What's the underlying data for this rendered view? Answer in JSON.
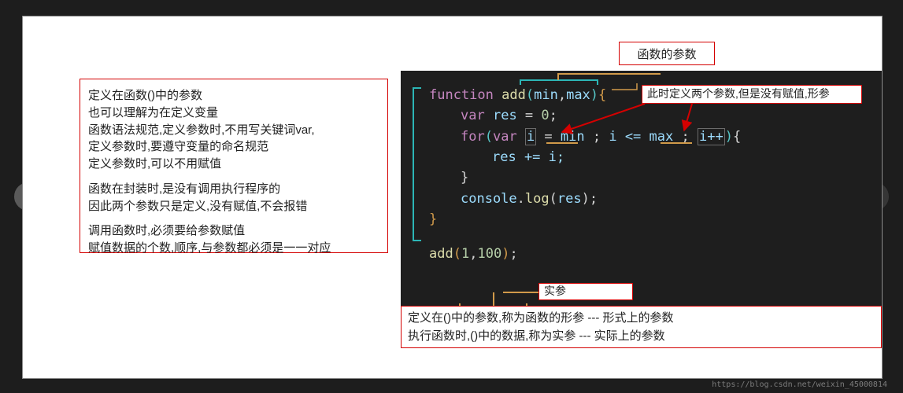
{
  "slide": {
    "title": "函数的参数",
    "left_notes": {
      "p1": "定义在函数()中的参数\n也可以理解为在定义变量\n函数语法规范,定义参数时,不用写关键词var,\n定义参数时,要遵守变量的命名规范\n定义参数时,可以不用赋值",
      "p2": "函数在封装时,是没有调用执行程序的\n因此两个参数只是定义,没有赋值,不会报错",
      "p3": "调用函数时,必须要给参数赋值\n赋值数据的个数,顺序,与参数都必须是一一对应"
    },
    "code": {
      "l1_kw": "function",
      "l1_fn": "add",
      "l1_p1": "min",
      "l1_p2": "max",
      "l2_kw": "var",
      "l2_id": "res",
      "l2_eq": " = ",
      "l2_num": "0",
      "l3_kw": "for",
      "l3_var": "var",
      "l3_i": "i",
      "l3_eq": " = ",
      "l3_min": "min",
      "l3_sep1": " ; ",
      "l3_cmp": "i <= ",
      "l3_max": "max",
      "l3_sep2": " ; ",
      "l3_inc": "i++",
      "l4_body": "res += i;",
      "l5_cb": "}",
      "l6_console": "console",
      "l6_dot": ".",
      "l6_log": "log",
      "l6_arg": "res",
      "l7_cb": "}",
      "call_fn": "add",
      "call_a1": "1",
      "call_a2": "100"
    },
    "annotations": {
      "param_note": "此时定义两个参数,但是没有赋值,形参",
      "actual_note": "实参"
    },
    "bottom_notes": {
      "l1": "定义在()中的参数,称为函数的形参 --- 形式上的参数",
      "l2": "执行函数时,()中的数据,称为实参 --- 实际上的参数"
    }
  },
  "nav": {
    "prev_glyph": "‹",
    "next_glyph": "›"
  },
  "watermark": "https://blog.csdn.net/weixin_45000814"
}
